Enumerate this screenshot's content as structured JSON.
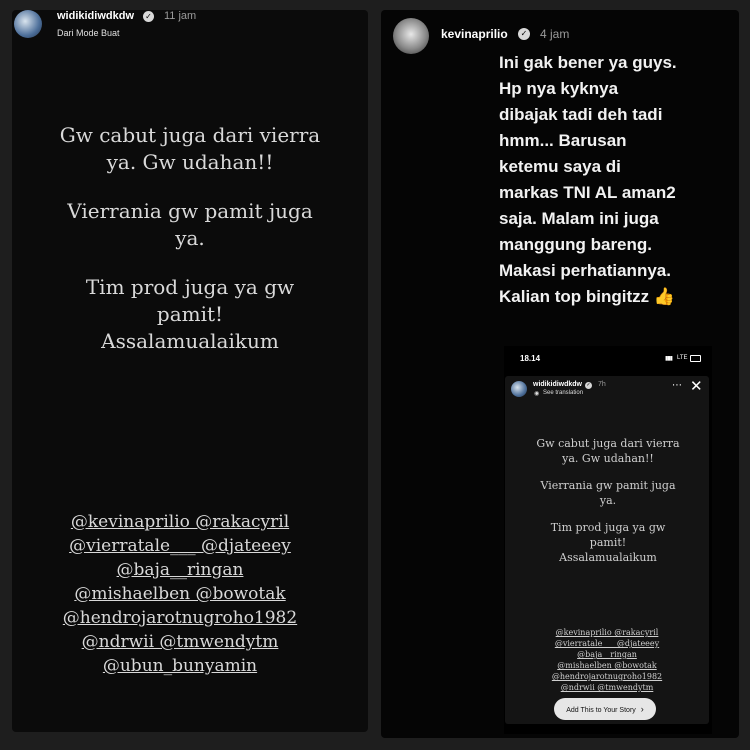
{
  "left_story": {
    "username": "widikidiwdkdw",
    "time": "11 jam",
    "subtitle": "Dari Mode Buat",
    "text_lines": [
      "Gw cabut juga dari vierra",
      "ya. Gw udahan!!",
      "",
      "Vierrania gw pamit juga",
      "ya.",
      "",
      "Tim prod juga ya gw",
      "pamit!",
      "Assalamualaikum"
    ],
    "mentions": [
      "@kevinaprilio @rakacyril",
      "@vierratale___ @djateeey",
      "@baja__ringan",
      "@mishaelben @bowotak",
      "@hendrojarotnugroho1982",
      "@ndrwii @tmwendytm",
      "@ubun_bunyamin"
    ]
  },
  "right_story": {
    "username": "kevinaprilio",
    "time": "4 jam",
    "text_lines": [
      "Ini gak bener ya guys.",
      "Hp nya kyknya",
      "dibajak tadi deh tadi",
      "hmm... Barusan",
      "ketemu saya di",
      "markas TNI AL aman2",
      "saja. Malam ini juga",
      "manggung bareng.",
      "Makasi perhatiannya.",
      "Kalian top bingitzz 👍"
    ],
    "embedded": {
      "clock": "18.14",
      "status": "LTE",
      "username": "widikidiwdkdw",
      "time": "7h",
      "see_translation": "See translation",
      "text_lines": [
        "Gw cabut juga dari vierra",
        "ya. Gw udahan!!",
        "",
        "Vierrania gw pamit juga",
        "ya.",
        "",
        "Tim prod juga ya gw",
        "pamit!",
        "Assalamualaikum"
      ],
      "mentions": [
        "@kevinaprilio @rakacyril",
        "@vierratale___ @djateeey",
        "@baja__ringan",
        "@mishaelben @bowotak",
        "@hendrojarotnugroho1982",
        "@ndrwii @tmwendytm"
      ],
      "add_button": "Add This to Your Story"
    }
  }
}
